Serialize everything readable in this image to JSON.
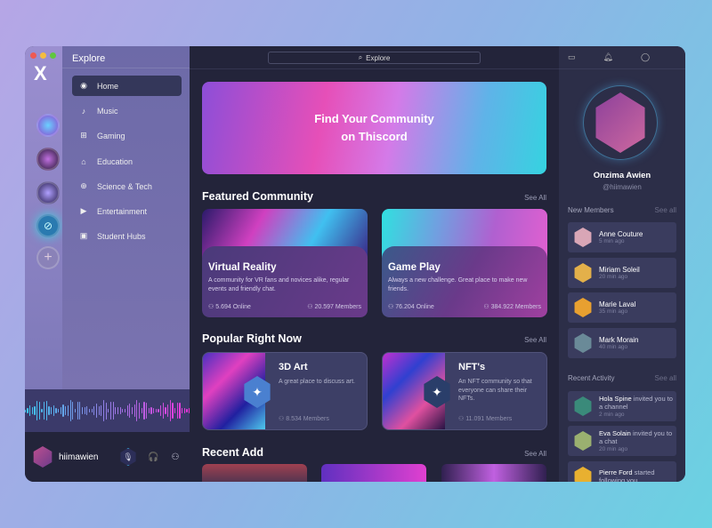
{
  "app": {
    "logo": "X"
  },
  "nav": {
    "title": "Explore",
    "items": [
      {
        "label": "Home",
        "icon": "compass-icon",
        "glyph": "◉"
      },
      {
        "label": "Music",
        "icon": "music-icon",
        "glyph": "♪"
      },
      {
        "label": "Gaming",
        "icon": "gamepad-icon",
        "glyph": "⊞"
      },
      {
        "label": "Education",
        "icon": "graduation-cap-icon",
        "glyph": "⌂"
      },
      {
        "label": "Science & Tech",
        "icon": "globe-icon",
        "glyph": "⊕"
      },
      {
        "label": "Entertainment",
        "icon": "play-icon",
        "glyph": "▶"
      },
      {
        "label": "Student Hubs",
        "icon": "building-icon",
        "glyph": "▣"
      }
    ],
    "active": "Home"
  },
  "user": {
    "username": "hiimawien"
  },
  "search": {
    "placeholder": "Explore"
  },
  "banner": {
    "line1": "Find Your Community",
    "line2": "on Thiscord"
  },
  "featured": {
    "title": "Featured Community",
    "see_all": "See All",
    "cards": [
      {
        "title": "Virtual Reality",
        "desc": "A community for VR  fans and novices alike, regular events and friendly chat.",
        "online": "5.694 Online",
        "members": "20.597 Members"
      },
      {
        "title": "Game Play",
        "desc": "Always a new challenge. Great place to make new friends.",
        "online": "76.204 Online",
        "members": "384.922 Members"
      }
    ]
  },
  "popular": {
    "title": "Popular Right Now",
    "see_all": "See All",
    "cards": [
      {
        "title": "3D Art",
        "desc": "A great place to discuss art.",
        "members": "8.534 Members"
      },
      {
        "title": "NFT's",
        "desc": "An NFT community so that everyone can share their NFTs.",
        "members": "11.091 Members"
      }
    ]
  },
  "recent_add": {
    "title": "Recent Add",
    "see_all": "See All"
  },
  "profile": {
    "name": "Onzima Awien",
    "handle": "@hiimawien"
  },
  "new_members": {
    "title": "New Members",
    "see_all": "See all",
    "items": [
      {
        "name": "Anne Couture",
        "time": "5 min ago",
        "color": "#d9a6b6"
      },
      {
        "name": "Miriam Soleil",
        "time": "20 min ago",
        "color": "#e3b04a"
      },
      {
        "name": "Marie Laval",
        "time": "35 min ago",
        "color": "#e8a030"
      },
      {
        "name": "Mark  Morain",
        "time": "40 min ago",
        "color": "#6a8a98"
      }
    ]
  },
  "recent_activity": {
    "title": "Recent Activity",
    "see_all": "See all",
    "items": [
      {
        "name": "Hola Spine",
        "action": " invited you to a channel",
        "time": "2 min ago",
        "color": "#3a8a7a"
      },
      {
        "name": "Eva Solain",
        "action": " invited you to a chat",
        "time": "20 min ago",
        "color": "#9ab070"
      },
      {
        "name": "Pierre Ford",
        "action": " started following you",
        "time": "",
        "color": "#e8b030"
      }
    ]
  }
}
